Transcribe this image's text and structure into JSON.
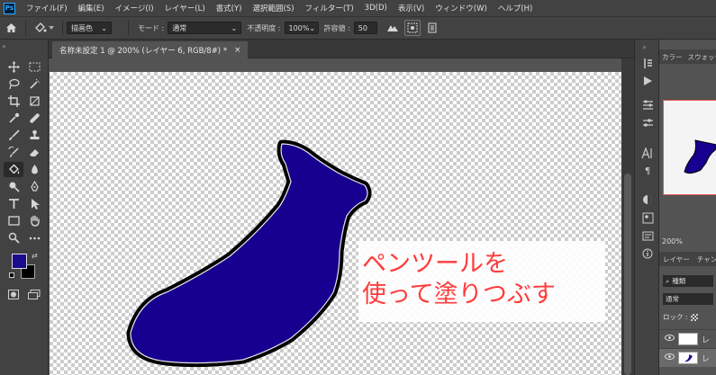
{
  "app_logo": "Ps",
  "menu": [
    "ファイル(F)",
    "編集(E)",
    "イメージ(I)",
    "レイヤー(L)",
    "書式(Y)",
    "選択範囲(S)",
    "フィルター(T)",
    "3D(D)",
    "表示(V)",
    "ウィンドウ(W)",
    "ヘルプ(H)"
  ],
  "options": {
    "fill_source": "描画色",
    "mode_label": "モード :",
    "mode_value": "通常",
    "opacity_label": "不透明度 :",
    "opacity_value": "100%",
    "tolerance_label": "許容値 :",
    "tolerance_value": "50"
  },
  "document_tab": {
    "title": "名称未設定 1 @ 200% (レイヤー 6, RGB/8#) *",
    "close": "×"
  },
  "caption": {
    "line1": "ペンツールを",
    "line2": "使って塗りつぶす"
  },
  "colors": {
    "foreground": "#1a0a8c",
    "background": "#000000",
    "shape_fill": "#17008f",
    "caption_text": "#ff3b3b"
  },
  "right_panel": {
    "color_tab": "カラー",
    "swatch_tab": "スウォッチ",
    "zoom": "200%",
    "layers_tab": "レイヤー",
    "channels_tab": "チャン",
    "kind_filter": "種類",
    "blend_mode": "通常",
    "lock_label": "ロック :",
    "layer_label_1": "レ",
    "layer_label_2": "レ"
  },
  "icons": [
    "home-icon",
    "paint-bucket-icon",
    "move-icon",
    "marquee-icon",
    "lasso-icon",
    "quick-select-icon",
    "crop-icon",
    "frame-icon",
    "eyedropper-icon",
    "healing-icon",
    "brush-icon",
    "stamp-icon",
    "history-brush-icon",
    "eraser-icon",
    "bucket-icon",
    "blur-icon",
    "dodge-icon",
    "pen-icon",
    "type-icon",
    "path-select-icon",
    "rectangle-icon",
    "hand-icon",
    "zoom-icon",
    "more-icon"
  ]
}
